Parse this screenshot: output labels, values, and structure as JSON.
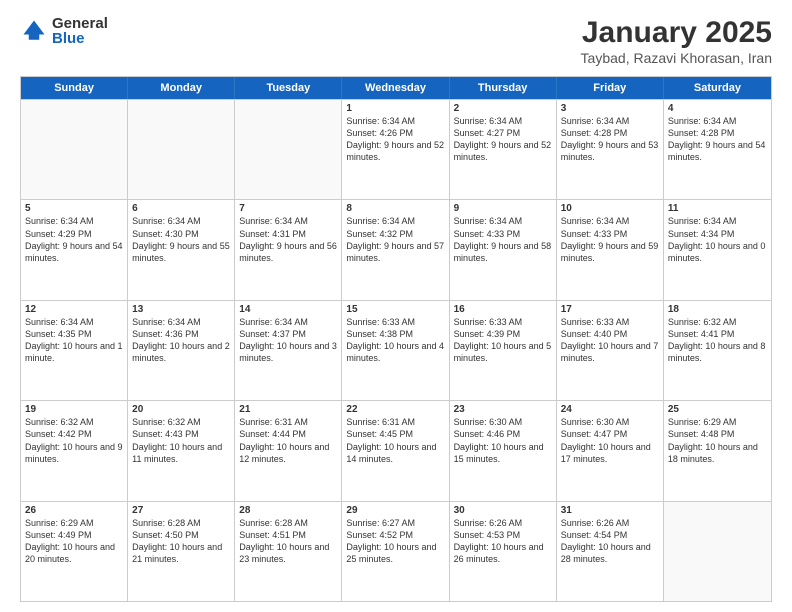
{
  "logo": {
    "general": "General",
    "blue": "Blue"
  },
  "calendar": {
    "title": "January 2025",
    "subtitle": "Taybad, Razavi Khorasan, Iran",
    "headers": [
      "Sunday",
      "Monday",
      "Tuesday",
      "Wednesday",
      "Thursday",
      "Friday",
      "Saturday"
    ],
    "rows": [
      [
        {
          "num": "",
          "info": "",
          "empty": true
        },
        {
          "num": "",
          "info": "",
          "empty": true
        },
        {
          "num": "",
          "info": "",
          "empty": true
        },
        {
          "num": "1",
          "info": "Sunrise: 6:34 AM\nSunset: 4:26 PM\nDaylight: 9 hours and 52 minutes."
        },
        {
          "num": "2",
          "info": "Sunrise: 6:34 AM\nSunset: 4:27 PM\nDaylight: 9 hours and 52 minutes."
        },
        {
          "num": "3",
          "info": "Sunrise: 6:34 AM\nSunset: 4:28 PM\nDaylight: 9 hours and 53 minutes."
        },
        {
          "num": "4",
          "info": "Sunrise: 6:34 AM\nSunset: 4:28 PM\nDaylight: 9 hours and 54 minutes."
        }
      ],
      [
        {
          "num": "5",
          "info": "Sunrise: 6:34 AM\nSunset: 4:29 PM\nDaylight: 9 hours and 54 minutes."
        },
        {
          "num": "6",
          "info": "Sunrise: 6:34 AM\nSunset: 4:30 PM\nDaylight: 9 hours and 55 minutes."
        },
        {
          "num": "7",
          "info": "Sunrise: 6:34 AM\nSunset: 4:31 PM\nDaylight: 9 hours and 56 minutes."
        },
        {
          "num": "8",
          "info": "Sunrise: 6:34 AM\nSunset: 4:32 PM\nDaylight: 9 hours and 57 minutes."
        },
        {
          "num": "9",
          "info": "Sunrise: 6:34 AM\nSunset: 4:33 PM\nDaylight: 9 hours and 58 minutes."
        },
        {
          "num": "10",
          "info": "Sunrise: 6:34 AM\nSunset: 4:33 PM\nDaylight: 9 hours and 59 minutes."
        },
        {
          "num": "11",
          "info": "Sunrise: 6:34 AM\nSunset: 4:34 PM\nDaylight: 10 hours and 0 minutes."
        }
      ],
      [
        {
          "num": "12",
          "info": "Sunrise: 6:34 AM\nSunset: 4:35 PM\nDaylight: 10 hours and 1 minute."
        },
        {
          "num": "13",
          "info": "Sunrise: 6:34 AM\nSunset: 4:36 PM\nDaylight: 10 hours and 2 minutes."
        },
        {
          "num": "14",
          "info": "Sunrise: 6:34 AM\nSunset: 4:37 PM\nDaylight: 10 hours and 3 minutes."
        },
        {
          "num": "15",
          "info": "Sunrise: 6:33 AM\nSunset: 4:38 PM\nDaylight: 10 hours and 4 minutes."
        },
        {
          "num": "16",
          "info": "Sunrise: 6:33 AM\nSunset: 4:39 PM\nDaylight: 10 hours and 5 minutes."
        },
        {
          "num": "17",
          "info": "Sunrise: 6:33 AM\nSunset: 4:40 PM\nDaylight: 10 hours and 7 minutes."
        },
        {
          "num": "18",
          "info": "Sunrise: 6:32 AM\nSunset: 4:41 PM\nDaylight: 10 hours and 8 minutes."
        }
      ],
      [
        {
          "num": "19",
          "info": "Sunrise: 6:32 AM\nSunset: 4:42 PM\nDaylight: 10 hours and 9 minutes."
        },
        {
          "num": "20",
          "info": "Sunrise: 6:32 AM\nSunset: 4:43 PM\nDaylight: 10 hours and 11 minutes."
        },
        {
          "num": "21",
          "info": "Sunrise: 6:31 AM\nSunset: 4:44 PM\nDaylight: 10 hours and 12 minutes."
        },
        {
          "num": "22",
          "info": "Sunrise: 6:31 AM\nSunset: 4:45 PM\nDaylight: 10 hours and 14 minutes."
        },
        {
          "num": "23",
          "info": "Sunrise: 6:30 AM\nSunset: 4:46 PM\nDaylight: 10 hours and 15 minutes."
        },
        {
          "num": "24",
          "info": "Sunrise: 6:30 AM\nSunset: 4:47 PM\nDaylight: 10 hours and 17 minutes."
        },
        {
          "num": "25",
          "info": "Sunrise: 6:29 AM\nSunset: 4:48 PM\nDaylight: 10 hours and 18 minutes."
        }
      ],
      [
        {
          "num": "26",
          "info": "Sunrise: 6:29 AM\nSunset: 4:49 PM\nDaylight: 10 hours and 20 minutes."
        },
        {
          "num": "27",
          "info": "Sunrise: 6:28 AM\nSunset: 4:50 PM\nDaylight: 10 hours and 21 minutes."
        },
        {
          "num": "28",
          "info": "Sunrise: 6:28 AM\nSunset: 4:51 PM\nDaylight: 10 hours and 23 minutes."
        },
        {
          "num": "29",
          "info": "Sunrise: 6:27 AM\nSunset: 4:52 PM\nDaylight: 10 hours and 25 minutes."
        },
        {
          "num": "30",
          "info": "Sunrise: 6:26 AM\nSunset: 4:53 PM\nDaylight: 10 hours and 26 minutes."
        },
        {
          "num": "31",
          "info": "Sunrise: 6:26 AM\nSunset: 4:54 PM\nDaylight: 10 hours and 28 minutes."
        },
        {
          "num": "",
          "info": "",
          "empty": true
        }
      ]
    ]
  }
}
